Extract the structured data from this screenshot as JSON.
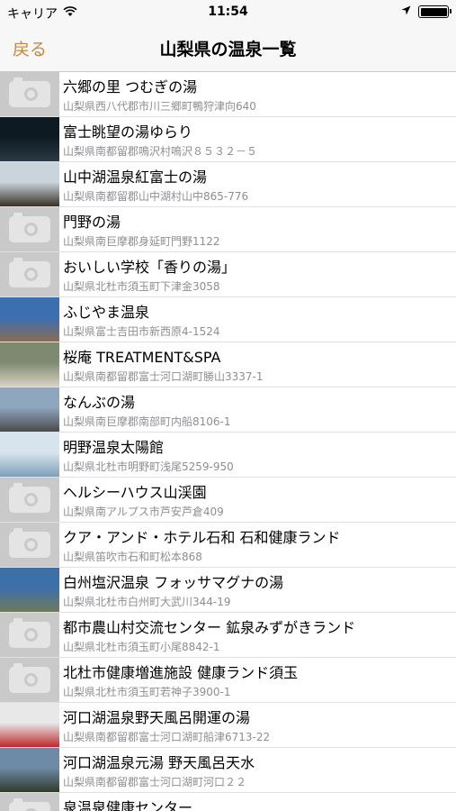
{
  "status_bar": {
    "carrier": "キャリア",
    "time": "11:54"
  },
  "nav": {
    "back_label": "戻る",
    "title": "山梨県の温泉一覧"
  },
  "colors": {
    "accent": "#c7883c"
  },
  "list": [
    {
      "title": "六郷の里 つむぎの湯",
      "address": "山梨県西八代郡市川三郷町鴨狩津向640",
      "thumb": "camera-icon"
    },
    {
      "title": "富士眺望の湯ゆらり",
      "address": "山梨県南都留郡鳴沢村鳴沢８５３２－５",
      "thumb": "photo",
      "photo_colors": [
        "#0d1a22",
        "#2b3a44"
      ]
    },
    {
      "title": "山中湖温泉紅富士の湯",
      "address": "山梨県南都留郡山中湖村山中865-776",
      "thumb": "photo",
      "photo_colors": [
        "#c9d4db",
        "#3a3128"
      ]
    },
    {
      "title": "門野の湯",
      "address": "山梨県南巨摩郡身延町門野1122",
      "thumb": "camera-icon"
    },
    {
      "title": "おいしい学校「香りの湯」",
      "address": "山梨県北杜市須玉町下津金3058",
      "thumb": "camera-icon"
    },
    {
      "title": "ふじやま温泉",
      "address": "山梨県富士吉田市新西原4-1524",
      "thumb": "photo",
      "photo_colors": [
        "#3c6fb0",
        "#8a6b55"
      ]
    },
    {
      "title": "桜庵 TREATMENT&SPA",
      "address": "山梨県南都留郡富士河口湖町勝山3337-1",
      "thumb": "photo",
      "photo_colors": [
        "#7d8a6f",
        "#d9d2c2"
      ]
    },
    {
      "title": "なんぶの湯",
      "address": "山梨県南巨摩郡南部町内船8106-1",
      "thumb": "photo",
      "photo_colors": [
        "#8fa6bf",
        "#4a4a4a"
      ]
    },
    {
      "title": "明野温泉太陽館",
      "address": "山梨県北杜市明野町浅尾5259-950",
      "thumb": "photo",
      "photo_colors": [
        "#d7e4ee",
        "#7da0b8"
      ]
    },
    {
      "title": "ヘルシーハウス山渓園",
      "address": "山梨県南アルプス市芦安芦倉409",
      "thumb": "camera-icon"
    },
    {
      "title": "クア・アンド・ホテル石和 石和健康ランド",
      "address": "山梨県笛吹市石和町松本868",
      "thumb": "camera-icon"
    },
    {
      "title": "白州塩沢温泉 フォッサマグナの湯",
      "address": "山梨県北杜市白州町大武川344-19",
      "thumb": "photo",
      "photo_colors": [
        "#3d6fa8",
        "#6f7a5d"
      ]
    },
    {
      "title": "都市農山村交流センター 鉱泉みずがきランド",
      "address": "山梨県北杜市須玉町小尾8842-1",
      "thumb": "camera-icon"
    },
    {
      "title": "北杜市健康増進施設 健康ランド須玉",
      "address": "山梨県北杜市須玉町若神子3900-1",
      "thumb": "camera-icon"
    },
    {
      "title": "河口湖温泉野天風呂開運の湯",
      "address": "山梨県南都留郡富士河口湖町船津6713-22",
      "thumb": "photo",
      "photo_colors": [
        "#e8e8e8",
        "#c0282d"
      ]
    },
    {
      "title": "河口湖温泉元湯 野天風呂天水",
      "address": "山梨県南都留郡富士河口湖町河口２２",
      "thumb": "photo",
      "photo_colors": [
        "#6e8aa6",
        "#2f3b2a"
      ]
    },
    {
      "title": "泉温泉健康センター",
      "address": "",
      "thumb": "camera-icon"
    }
  ]
}
